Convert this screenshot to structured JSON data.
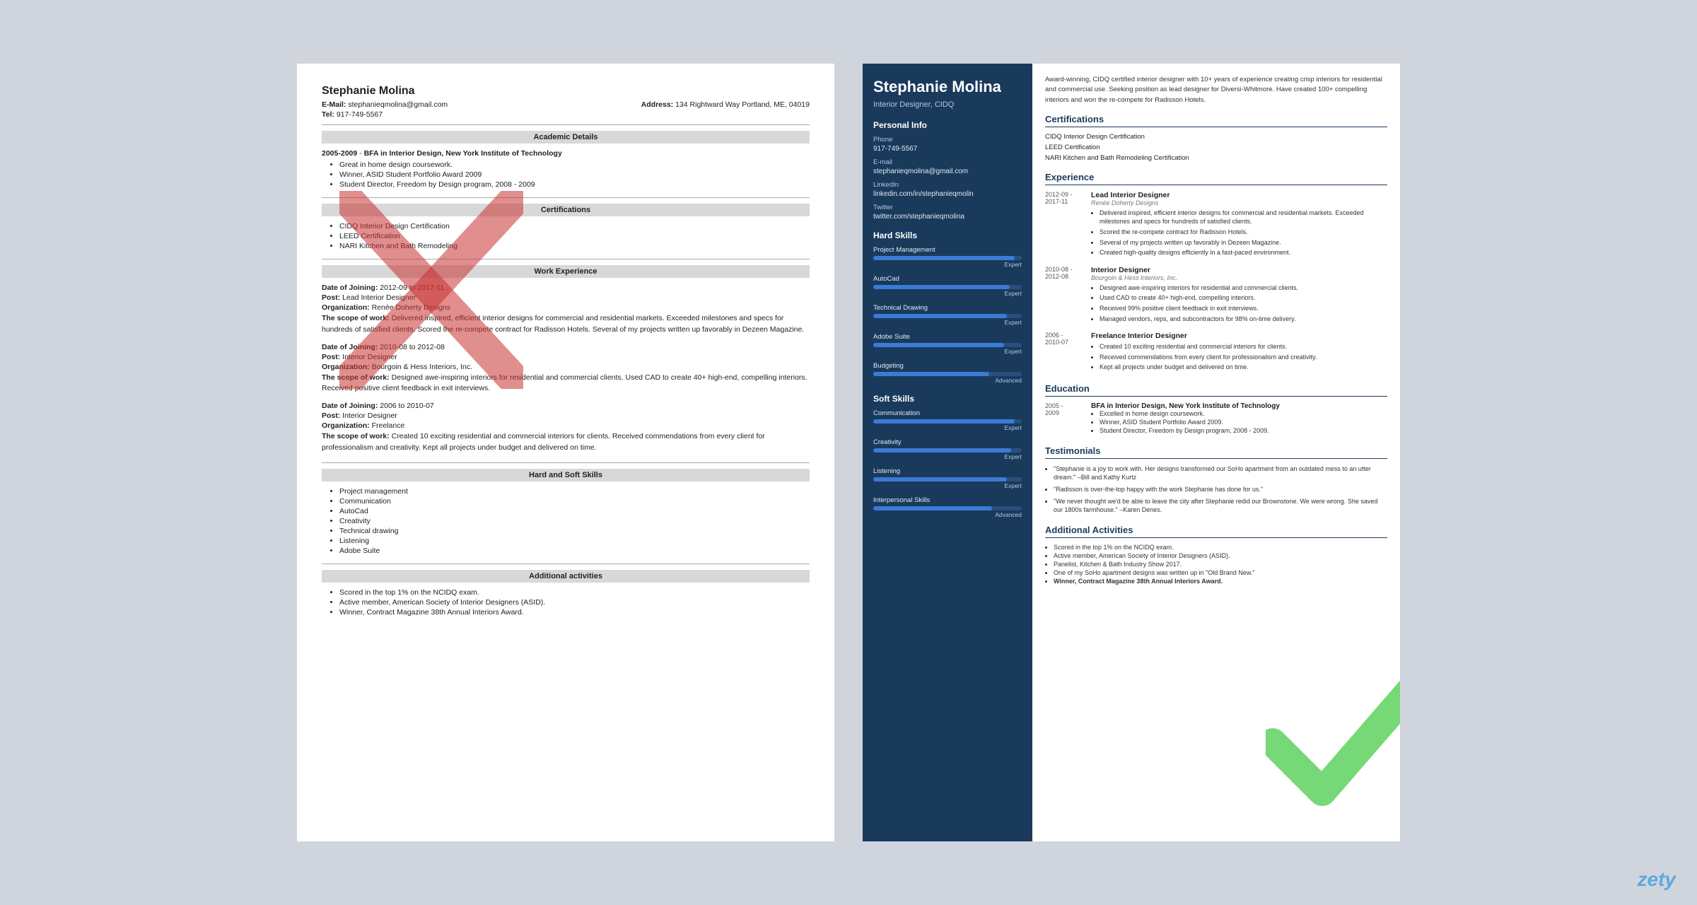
{
  "page": {
    "brand": "zety"
  },
  "left_resume": {
    "name": "Stephanie Molina",
    "email_label": "E-Mail:",
    "email": "stephanieqmolina@gmail.com",
    "address_label": "Address:",
    "address": "134 Rightward Way Portland, ME, 04019",
    "tel_label": "Tel:",
    "tel": "917-749-5567",
    "sections": {
      "academic": {
        "title": "Academic Details",
        "entries": [
          {
            "dates": "2005-2009",
            "degree": "BFA in Interior Design, New York Institute of Technology",
            "bullets": [
              "Great in home design coursework.",
              "Winner, ASID Student Portfolio Award 2009",
              "Student Director, Freedom by Design program, 2008 - 2009"
            ]
          }
        ]
      },
      "certifications": {
        "title": "Certifications",
        "items": [
          "CIDQ Interior Design Certification",
          "LEED Certification",
          "NARI Kitchen and Bath Remodeling"
        ]
      },
      "work": {
        "title": "Work Experience",
        "jobs": [
          {
            "date_label": "Date of Joining:",
            "dates": "2012-09 to 2017-11",
            "post_label": "Post:",
            "post": "Lead Interior Designer",
            "org_label": "Organization:",
            "org": "Renée Doherty Designs",
            "scope_label": "The scope of work:",
            "scope": "Delivered inspired, efficient interior designs for commercial and residential markets. Exceeded milestones and specs for hundreds of satisfied clients. Scored the re-compete contract for Radisson Hotels. Several of my projects written up favorably in Dezeen Magazine."
          },
          {
            "date_label": "Date of Joining:",
            "dates": "2010-08 to 2012-08",
            "post_label": "Post:",
            "post": "Interior Designer",
            "org_label": "Organization:",
            "org": "Bourgoin & Hess Interiors, Inc.",
            "scope_label": "The scope of work:",
            "scope": "Designed awe-inspiring interiors for residential and commercial clients. Used CAD to create 40+ high-end, compelling interiors. Received positive client feedback in exit interviews."
          },
          {
            "date_label": "Date of Joining:",
            "dates": "2006 to 2010-07",
            "post_label": "Post:",
            "post": "Interior Designer",
            "org_label": "Organization:",
            "org": "Freelance",
            "scope_label": "The scope of work:",
            "scope": "Created 10 exciting residential and commercial interiors for clients. Received commendations from every client for professionalism and creativity. Kept all projects under budget and delivered on time."
          }
        ]
      },
      "skills": {
        "title": "Hard and Soft Skills",
        "items": [
          "Project management",
          "Communication",
          "AutoCad",
          "Creativity",
          "Technical drawing",
          "Listening",
          "Adobe Suite"
        ]
      },
      "additional": {
        "title": "Additional activities",
        "items": [
          "Scored in the top 1% on the NCIDQ exam.",
          "Active member, American Society of Interior Designers (ASID).",
          "Winner, Contract Magazine 38th Annual Interiors Award."
        ]
      }
    }
  },
  "right_resume": {
    "name": "Stephanie Molina",
    "title": "Interior Designer, CIDQ",
    "summary": "Award-winning, CIDQ certified interior designer with 10+ years of experience creating crisp interiors for residential and commercial use. Seeking position as lead designer for Diversi-Whitmore. Have created 100+ compelling interiors and won the re-compete for Radisson Hotels.",
    "sidebar": {
      "personal_info_title": "Personal Info",
      "phone_label": "Phone",
      "phone": "917-749-5567",
      "email_label": "E-mail",
      "email": "stephanieqmolina@gmail.com",
      "linkedin_label": "LinkedIn",
      "linkedin": "linkedin.com/in/stephanieqmolin",
      "twitter_label": "Twitter",
      "twitter": "twitter.com/stephanieqmolina",
      "hard_skills_title": "Hard Skills",
      "hard_skills": [
        {
          "name": "Project Management",
          "level": "Expert",
          "pct": 95
        },
        {
          "name": "AutoCad",
          "level": "Expert",
          "pct": 92
        },
        {
          "name": "Technical Drawing",
          "level": "Expert",
          "pct": 90
        },
        {
          "name": "Adobe Suite",
          "level": "Expert",
          "pct": 88
        },
        {
          "name": "Budgeting",
          "level": "Advanced",
          "pct": 78
        }
      ],
      "soft_skills_title": "Soft Skills",
      "soft_skills": [
        {
          "name": "Communication",
          "level": "Expert",
          "pct": 95
        },
        {
          "name": "Creativity",
          "level": "Expert",
          "pct": 93
        },
        {
          "name": "Listening",
          "level": "Expert",
          "pct": 90
        },
        {
          "name": "Interpersonal Skills",
          "level": "Advanced",
          "pct": 80
        }
      ]
    },
    "certifications_title": "Certifications",
    "certifications": [
      "CIDQ Interior Design Certification",
      "LEED Certification",
      "NARI Kitchen and Bath Remodeling Certification"
    ],
    "experience_title": "Experience",
    "experience": [
      {
        "dates": "2012-09 - 2017-11",
        "title": "Lead Interior Designer",
        "company": "Renée Doherty Designs",
        "bullets": [
          "Delivered inspired, efficient interior designs for commercial and residential markets. Exceeded milestones and specs for hundreds of satisfied clients.",
          "Scored the re-compete contract for Radisson Hotels.",
          "Several of my projects written up favorably in Dezeen Magazine.",
          "Created high-quality designs efficiently in a fast-paced environment."
        ]
      },
      {
        "dates": "2010-08 - 2012-08",
        "title": "Interior Designer",
        "company": "Bourgoin & Hess Interiors, Inc.",
        "bullets": [
          "Designed awe-inspiring interiors for residential and commercial clients.",
          "Used CAD to create 40+ high-end, compelling interiors.",
          "Received 99% positive client feedback in exit interviews.",
          "Managed vendors, reps, and subcontractors for 98% on-time delivery."
        ]
      },
      {
        "dates": "2006 - 2010-07",
        "title": "Freelance Interior Designer",
        "company": "",
        "bullets": [
          "Created 10 exciting residential and commercial interiors for clients.",
          "Received commendations from every client for professionalism and creativity.",
          "Kept all projects under budget and delivered on time."
        ]
      }
    ],
    "education_title": "Education",
    "education": [
      {
        "dates": "2005 - 2009",
        "title": "BFA in Interior Design, New York Institute of Technology",
        "bullets": [
          "Excelled in home design coursework.",
          "Winner, ASID Student Portfolio Award 2009.",
          "Student Director, Freedom by Design program, 2008 - 2009."
        ]
      }
    ],
    "testimonials_title": "Testimonials",
    "testimonials": [
      "\"Stephanie is a joy to work with. Her designs transformed our SoHo apartment from an outdated mess to an utter dream.\" –Bill and Kathy Kurtz",
      "\"Radisson is over-the-top happy with the work Stephanie has done for us.\"",
      "\"We never thought we'd be able to leave the city after Stephanie redid our Brownstone. We were wrong. She saved our 1800s farmhouse.\" –Karen Denes."
    ],
    "additional_title": "Additional Activities",
    "additional": [
      "Scored in the top 1% on the NCIDQ exam.",
      "Active member, American Society of Interior Designers (ASID).",
      "Panelist, Kitchen & Bath Industry Show 2017.",
      "One of my SoHo apartment designs was written up in \"Old Brand New.\"",
      "Winner, Contract Magazine 38th Annual Interiors Award."
    ]
  }
}
